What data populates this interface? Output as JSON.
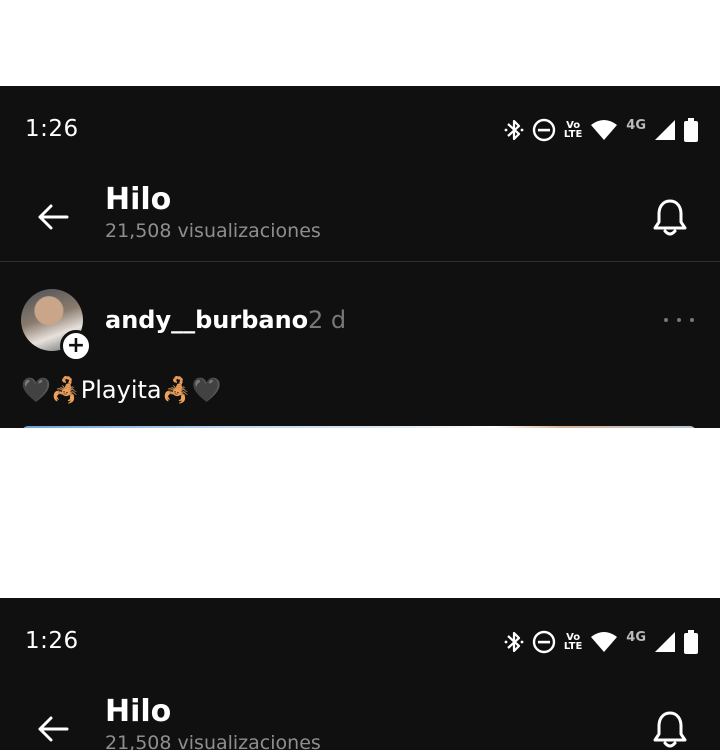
{
  "status_bar": {
    "time": "1:26",
    "network_label": "4G",
    "volte_label_top": "Vo",
    "volte_label_bottom": "LTE"
  },
  "header": {
    "title": "Hilo",
    "views": "21,508 visualizaciones"
  },
  "post": {
    "username": "andy__burbano",
    "time_ago": "2 d",
    "text": "🖤🦂Playita🦂🖤"
  },
  "colors": {
    "background": "#101010",
    "text_primary": "#ffffff",
    "text_secondary": "#8e8e8e"
  },
  "icons": [
    "bluetooth-icon",
    "do-not-disturb-icon",
    "volte-icon",
    "wifi-icon",
    "signal-icon",
    "battery-icon",
    "back-arrow-icon",
    "bell-icon",
    "add-icon",
    "more-icon"
  ]
}
